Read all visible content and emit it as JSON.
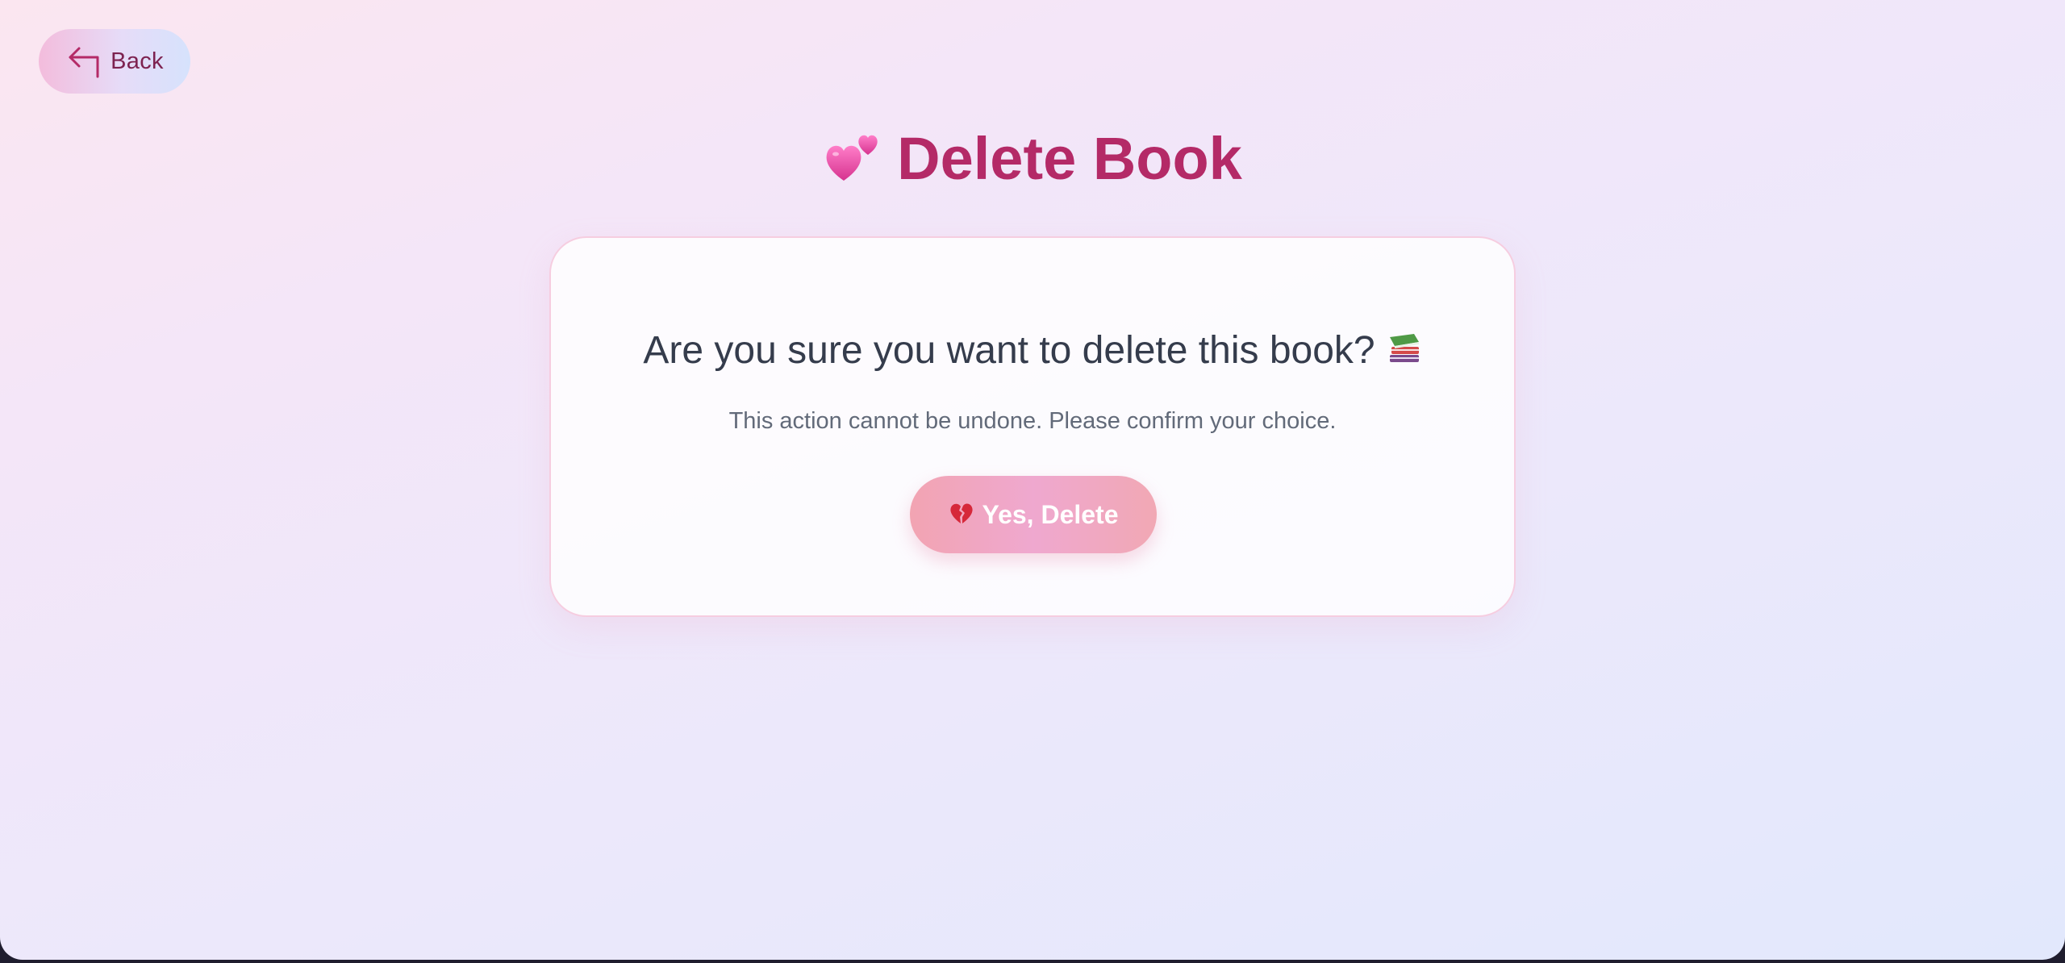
{
  "header": {
    "back_label": "Back",
    "back_icon": "corner-up-left-icon"
  },
  "page": {
    "title": "Delete Book",
    "title_icon": "two-hearts-icon"
  },
  "dialog": {
    "question": "Are you sure you want to delete this book?",
    "question_icon": "books-icon",
    "subtext": "This action cannot be undone. Please confirm your choice.",
    "confirm_label": "Yes, Delete",
    "confirm_icon": "broken-heart-icon"
  },
  "colors": {
    "title": "#b42a67",
    "back_text": "#7d2250",
    "question_text": "#353c4c",
    "subtext": "#626a79",
    "confirm_gradient": [
      "#f2a4b2",
      "#efa8cf"
    ]
  }
}
